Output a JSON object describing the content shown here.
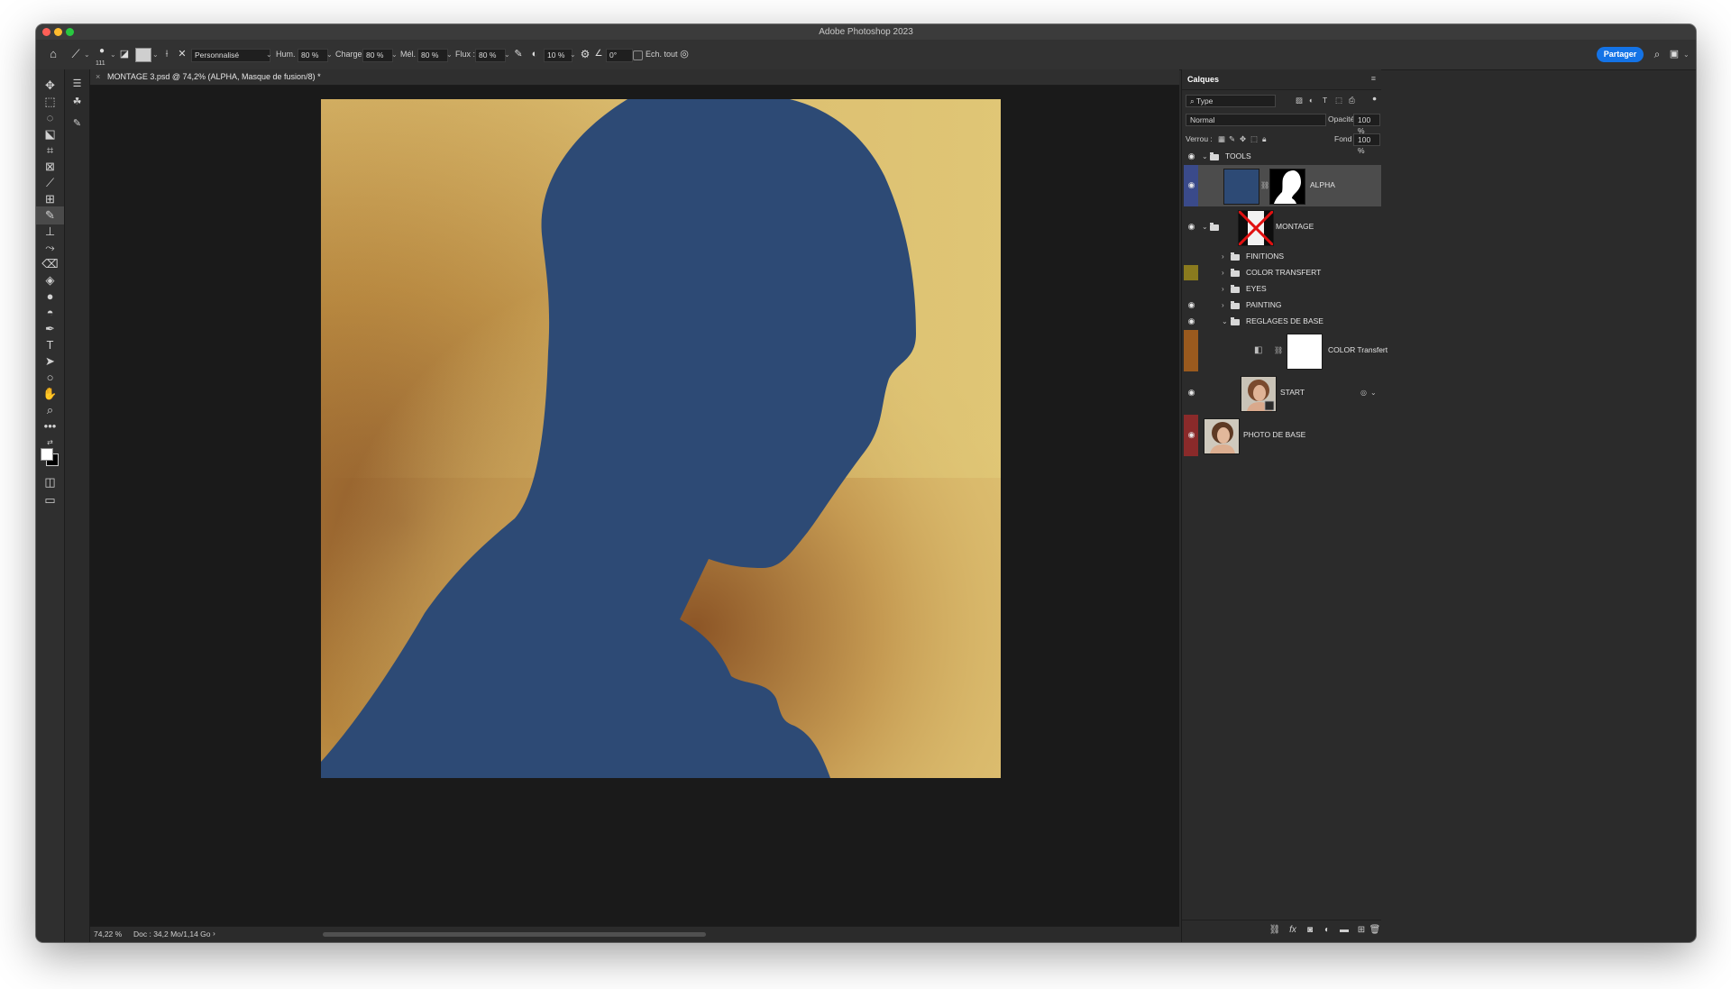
{
  "window": {
    "title": "Adobe Photoshop 2023"
  },
  "options": {
    "tool_size": "111",
    "preset": "Personnalisé",
    "wet_label": "Hum. :",
    "wet_value": "80 %",
    "load_label": "Charge :",
    "load_value": "80 %",
    "mix_label": "Mél. :",
    "mix_value": "80 %",
    "flow_label": "Flux :",
    "flow_value": "80 %",
    "smoothing_value": "10 %",
    "angle_value": "0°",
    "sample_all_label": "Ech. tout",
    "share_label": "Partager"
  },
  "document": {
    "tab_close": "×",
    "tab_title": "MONTAGE 3.psd @ 74,2% (ALPHA, Masque de fusion/8) *"
  },
  "status": {
    "zoom": "74,22 %",
    "doc_info": "Doc : 34,2 Mo/1,14 Go",
    "arrow": "›"
  },
  "layers_panel": {
    "title": "Calques",
    "filter_value": "Type",
    "blend_mode": "Normal",
    "opacity_label": "Opacité :",
    "opacity_value": "100 %",
    "lock_label": "Verrou :",
    "fill_label": "Fond :",
    "fill_value": "100 %",
    "layers": [
      {
        "name": "TOOLS",
        "kind": "group",
        "visible": true,
        "tag": ""
      },
      {
        "name": "ALPHA",
        "kind": "layer-mask",
        "visible": true,
        "tag": "#3a4a8a",
        "selected": true
      },
      {
        "name": "MONTAGE",
        "kind": "group-thumb",
        "visible": true,
        "tag": ""
      },
      {
        "name": "FINITIONS",
        "kind": "group",
        "visible": false,
        "tag": ""
      },
      {
        "name": "COLOR TRANSFERT",
        "kind": "group",
        "visible": false,
        "tag": "#8a7a1e"
      },
      {
        "name": "EYES",
        "kind": "group",
        "visible": false,
        "tag": ""
      },
      {
        "name": "PAINTING",
        "kind": "group",
        "visible": true,
        "tag": ""
      },
      {
        "name": "REGLAGES DE BASE",
        "kind": "group",
        "visible": true,
        "tag": ""
      },
      {
        "name": "COLOR Transfert",
        "kind": "adjustment",
        "visible": false,
        "tag": "#9a5a1e"
      },
      {
        "name": "START",
        "kind": "smart-photo",
        "visible": true,
        "tag": ""
      },
      {
        "name": "PHOTO DE BASE",
        "kind": "photo",
        "visible": true,
        "tag": "#8a2a2a"
      }
    ]
  },
  "colors": {
    "selected_layer_tag": "#3a4a8a",
    "accent": "#1473e6",
    "silhouette": "#2d4a75",
    "background_gold": "#d8b865",
    "background_brown": "#8e5a2a"
  }
}
